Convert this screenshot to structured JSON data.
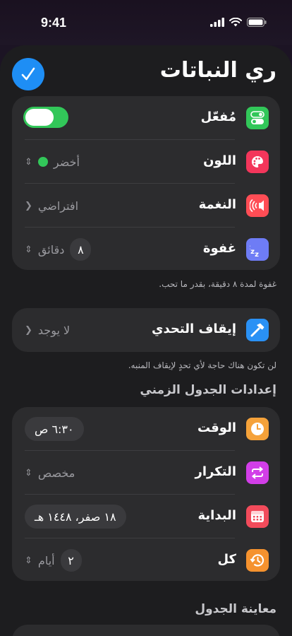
{
  "status": {
    "time": "9:41"
  },
  "title": "ري النباتات",
  "toggle_group": {
    "rows": [
      {
        "label": "مُفعّل",
        "enabled": true
      },
      {
        "label": "اللون",
        "value": "أخضر",
        "dot_color": "#32c759"
      },
      {
        "label": "النغمة",
        "value": "افتراضي"
      },
      {
        "label": "غفوة",
        "unit": "دقائق",
        "number": "٨"
      }
    ],
    "footer": "غفوة لمدة ٨ دقيقة، بقدر ما تحب."
  },
  "challenge": {
    "label": "إيقاف التحدي",
    "value": "لا يوجد",
    "footer": "لن تكون هناك حاجة لأي تحدٍ لإيقاف المنبه."
  },
  "schedule": {
    "header": "إعدادات الجدول الزمني",
    "rows": [
      {
        "label": "الوقت",
        "value": "٦:٣٠ ص"
      },
      {
        "label": "التكرار",
        "value": "مخصص"
      },
      {
        "label": "البداية",
        "value": "١٨ صفر، ١٤٤٨ هـ"
      },
      {
        "label": "كل",
        "unit": "أيام",
        "number": "٢"
      }
    ]
  },
  "preview": {
    "header": "معاينة الجدول"
  },
  "colors": {
    "accent": "#1e8ef5",
    "toggle_on": "#32c759",
    "sheet_bg": "#1d1d1f",
    "cell_bg": "#2c2c2e"
  },
  "icons": {
    "enabled": "toggle-icon",
    "color": "palette-icon",
    "tone": "speaker-icon",
    "snooze": "zzz-icon",
    "challenge": "hammer-icon",
    "time": "clock-icon",
    "repeat": "repeat-icon",
    "start": "calendar-icon",
    "every": "history-icon"
  }
}
